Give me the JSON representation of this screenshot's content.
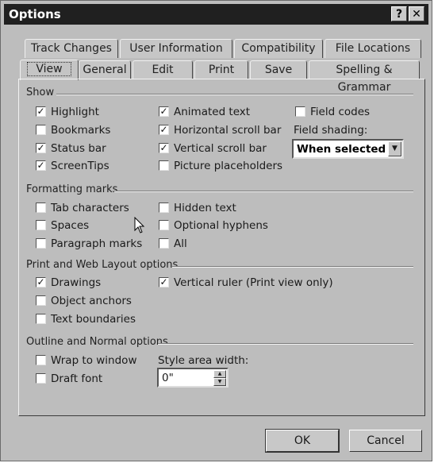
{
  "window": {
    "title": "Options",
    "help_glyph": "?",
    "close_glyph": "✕"
  },
  "tabs_back": [
    "Track Changes",
    "User Information",
    "Compatibility",
    "File Locations"
  ],
  "tabs_front": [
    "View",
    "General",
    "Edit",
    "Print",
    "Save",
    "Spelling & Grammar"
  ],
  "active_tab": "View",
  "show": {
    "heading": "Show",
    "col1": [
      {
        "label": "Highlight",
        "checked": true
      },
      {
        "label": "Bookmarks",
        "checked": false
      },
      {
        "label": "Status bar",
        "checked": true
      },
      {
        "label": "ScreenTips",
        "checked": true
      }
    ],
    "col2": [
      {
        "label": "Animated text",
        "checked": true
      },
      {
        "label": "Horizontal scroll bar",
        "checked": true
      },
      {
        "label": "Vertical scroll bar",
        "checked": true
      },
      {
        "label": "Picture placeholders",
        "checked": false
      }
    ],
    "field_codes": {
      "label": "Field codes",
      "checked": false
    },
    "field_shading_label": "Field shading:",
    "field_shading_value": "When selected"
  },
  "formatting": {
    "heading": "Formatting marks",
    "col1": [
      {
        "label": "Tab characters",
        "checked": false
      },
      {
        "label": "Spaces",
        "checked": false
      },
      {
        "label": "Paragraph marks",
        "checked": false
      }
    ],
    "col2": [
      {
        "label": "Hidden text",
        "checked": false
      },
      {
        "label": "Optional hyphens",
        "checked": false
      },
      {
        "label": "All",
        "checked": false
      }
    ]
  },
  "print_web": {
    "heading": "Print and Web Layout options",
    "col1": [
      {
        "label": "Drawings",
        "checked": true
      },
      {
        "label": "Object anchors",
        "checked": false
      },
      {
        "label": "Text boundaries",
        "checked": false
      }
    ],
    "vertical_ruler": {
      "label": "Vertical ruler (Print view only)",
      "checked": true
    }
  },
  "outline": {
    "heading": "Outline and Normal options",
    "col1": [
      {
        "label": "Wrap to window",
        "checked": false
      },
      {
        "label": "Draft font",
        "checked": false
      }
    ],
    "style_area_label": "Style area width:",
    "style_area_value": "0\""
  },
  "buttons": {
    "ok": "OK",
    "cancel": "Cancel"
  },
  "check_glyph": "✓"
}
